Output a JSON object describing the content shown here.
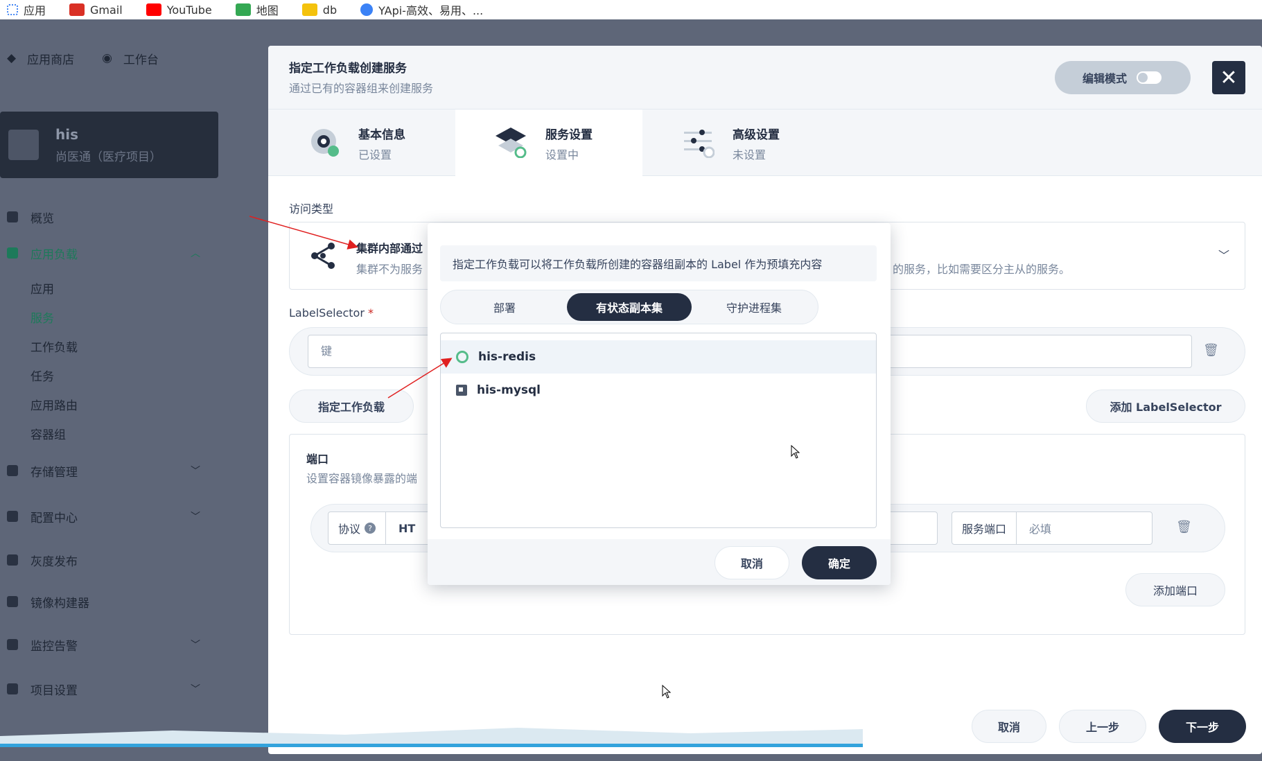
{
  "bookmarks": [
    {
      "label": "应用",
      "icon": "apps-icon",
      "color": "#ffffff"
    },
    {
      "label": "Gmail",
      "icon": "gmail-icon",
      "color": "#d93025"
    },
    {
      "label": "YouTube",
      "icon": "youtube-icon",
      "color": "#ff0000"
    },
    {
      "label": "地图",
      "icon": "maps-icon",
      "color": "#34a853"
    },
    {
      "label": "db",
      "icon": "folder-icon",
      "color": "#f4c20d"
    },
    {
      "label": "YApi-高效、易用、...",
      "icon": "yapi-icon",
      "color": "#3b82f6"
    }
  ],
  "background": {
    "topnav": {
      "store": "应用商店",
      "workbench": "工作台"
    },
    "project": {
      "name": "his",
      "desc": "尚医通（医疗项目）"
    },
    "menu": {
      "overview": "概览",
      "app_workloads": "应用负载",
      "subs": [
        "应用",
        "服务",
        "工作负载",
        "任务",
        "应用路由",
        "容器组"
      ],
      "storage": "存储管理",
      "config": "配置中心",
      "gray": "灰度发布",
      "image_builder": "镜像构建器",
      "monitoring": "监控告警",
      "project_settings": "项目设置"
    }
  },
  "modal": {
    "title": "指定工作负载创建服务",
    "subtitle": "通过已有的容器组来创建服务",
    "edit_mode": "编辑模式",
    "steps": [
      {
        "title": "基本信息",
        "status": "已设置"
      },
      {
        "title": "服务设置",
        "status": "设置中"
      },
      {
        "title": "高级设置",
        "status": "未设置"
      }
    ],
    "access_type_label": "访问类型",
    "access_title": "集群内部通过",
    "access_desc": "集群不为服务",
    "access_desc_tail": "的服务，比如需要区分主从的服务。",
    "label_selector_label": "LabelSelector",
    "required_mark": "*",
    "key_placeholder": "键",
    "specify_workload": "指定工作负载",
    "add_label_selector": "添加 LabelSelector",
    "ports": {
      "title": "端口",
      "desc": "设置容器镜像暴露的端",
      "protocol_label": "协议",
      "protocol_value": "HT",
      "service_port_label": "服务端口",
      "service_port_placeholder": "必填",
      "add_port": "添加端口"
    },
    "footer": {
      "cancel": "取消",
      "prev": "上一步",
      "next": "下一步"
    }
  },
  "popup": {
    "tip": "指定工作负载可以将工作负载所创建的容器组副本的 Label 作为预填充内容",
    "tabs": [
      "部署",
      "有状态副本集",
      "守护进程集"
    ],
    "active_tab": 1,
    "items": [
      "his-redis",
      "his-mysql"
    ],
    "selected_item": 0,
    "cancel": "取消",
    "confirm": "确定"
  },
  "colors": {
    "accent": "#242e42",
    "green": "#55bc8a",
    "annotation": "#e02020"
  }
}
